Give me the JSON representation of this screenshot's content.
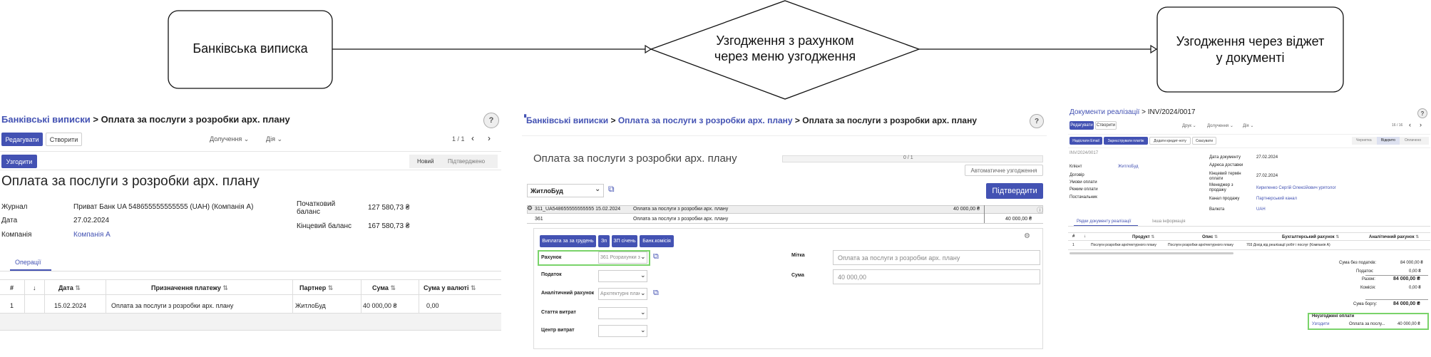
{
  "flow": {
    "start": "Банківська виписка",
    "decision_line1": "Узгодження з рахунком",
    "decision_line2": "через меню узгодження",
    "end_line1": "Узгодження через віджет",
    "end_line2": "у документі"
  },
  "panel1": {
    "breadcrumb_root": "Банківські виписки",
    "breadcrumb_sep": ">",
    "breadcrumb_current": "Оплата за послуги з розробки арх. плану",
    "help": "?",
    "edit_btn": "Редагувати",
    "create_btn": "Створити",
    "attached": "Долучення",
    "action": "Дія",
    "pager": "1 / 1",
    "reconcile_btn": "Узгодити",
    "status_new": "Новий",
    "status_confirmed": "Підтверджено",
    "title": "Оплата за послуги з розробки арх. плану",
    "journal_label": "Журнал",
    "journal_value": "Приват Банк UA 548655555555555 (UAH) (Компанія А)",
    "date_label": "Дата",
    "date_value": "27.02.2024",
    "company_label": "Компанія",
    "company_value": "Компанія А",
    "start_balance_label_1": "Початковий",
    "start_balance_label_2": "баланс",
    "start_balance_value": "127 580,73 ₴",
    "end_balance_label": "Кінцевий баланс",
    "end_balance_value": "167 580,73 ₴",
    "tab_operations": "Операції",
    "columns": [
      "#",
      "↓",
      "Дата",
      "Призначення платежу",
      "Партнер",
      "Сума",
      "Сума у валюті"
    ],
    "row": [
      "1",
      "",
      "15.02.2024",
      "Оплата за послуги з розробки арх. плану",
      "ЖитлоБуд",
      "40 000,00 ₴",
      "0,00"
    ]
  },
  "panel2": {
    "breadcrumb_root": "Банківські виписки",
    "breadcrumb_mid": "Оплата за послуги з розробки арх. плану",
    "breadcrumb_current": "Оплата за послуги з розробки арх. плану",
    "help": "?",
    "title": "Оплата за послуги з розробки арх. плану",
    "progress": "0 / 1",
    "auto_btn": "Автоматичне узгодження",
    "partner_value": "ЖитлоБуд",
    "confirm_btn": "Підтвердити",
    "line1_account": "311_UA548655555555555 15.02.2024",
    "line1_label": "Оплата за послуги з розробки арх. плану",
    "line1_amount": "40 000,00 ₴",
    "line2_account": "361",
    "line2_label": "Оплата за послуги з розробки арх. плану",
    "line2_amount": "40 000,00 ₴",
    "btn_full": "Виплата за за грудень",
    "btn_zp": "Зп",
    "btn_zp_jan": "ЗП січень",
    "btn_bank_fee": "Банк.комісія",
    "account_label": "Рахунок",
    "account_value": "361 Розрахунки з вітчи",
    "tax_label": "Податок",
    "analytic_label": "Аналітичний рахунок",
    "analytic_value": "Архітектурні плани (Ком",
    "cost_item_label": "Стаття витрат",
    "cost_center_label": "Центр витрат",
    "label_label": "Мітка",
    "label_value": "Оплата за послуги з розробки арх. плану",
    "amount_label": "Сума",
    "amount_value": "40 000,00"
  },
  "panel3": {
    "breadcrumb_root": "Документи реалізації",
    "breadcrumb_current": "INV/2024/0017",
    "help": "?",
    "edit_btn": "Редагувати",
    "create_btn": "Створити",
    "print": "Друк",
    "attached": "Долучення",
    "action": "Дія",
    "pager": "16 / 16",
    "btn_send": "Надіслати Email",
    "btn_register": "Зареєструвати платіж",
    "btn_credit": "Додати кредит-ноту",
    "btn_cancel": "Скасувати",
    "status_draft": "Чернетка",
    "status_posted": "Відкрито",
    "status_paid": "Оплачено",
    "doc_number": "INV/2024/0017",
    "client_label": "Клієнт",
    "client_value": "ЖитлоБуд",
    "contract_label": "Договір",
    "payment_terms_label": "Умови оплати",
    "payment_mode_label": "Режим оплати",
    "supplier_label": "Постачальник",
    "doc_date_label": "Дата документу",
    "doc_date_value": "27.02.2024",
    "delivery_label": "Адреса доставки",
    "due_date_label_1": "Кінцевий термін",
    "due_date_label_2": "оплати",
    "due_date_value": "27.02.2024",
    "manager_label_1": "Менеджер з",
    "manager_label_2": "продажу",
    "manager_value": "Кириленко Сергій Олексійович урятолог",
    "sales_channel_label": "Канал продажу",
    "sales_channel_value": "Партнерський канал",
    "currency_label": "Валюта",
    "currency_value": "UAH",
    "tab_lines": "Рядки документу реалізації",
    "tab_other": "Інша інформація",
    "columns": [
      "#",
      "↓",
      "Продукт",
      "Опис",
      "Бухгалтерський рахунок",
      "Аналітичний рахунок"
    ],
    "row": [
      "1",
      "",
      "Послуги розробки архітектурного плану",
      "Послуги розробки архітектурного плану",
      "703 Дохід від реалізації робіт і послуг (Компанія А)",
      ""
    ],
    "untaxed_label": "Сума без податків:",
    "untaxed_value": "84 000,00 ₴",
    "taxes_label": "Податок:",
    "taxes_value": "0,00 ₴",
    "total_label": "Разом:",
    "total_value": "84 000,00 ₴",
    "fee_label": "Комісія:",
    "fee_value": "0,00 ₴",
    "amount_due_label": "Сума боргу:",
    "amount_due_value": "84 000,00 ₴",
    "outstanding_title": "Неузгоджені оплати",
    "outstanding_add": "Узгодити",
    "outstanding_desc": "Оплата за послу...",
    "outstanding_amount": "40 000,00 ₴"
  }
}
